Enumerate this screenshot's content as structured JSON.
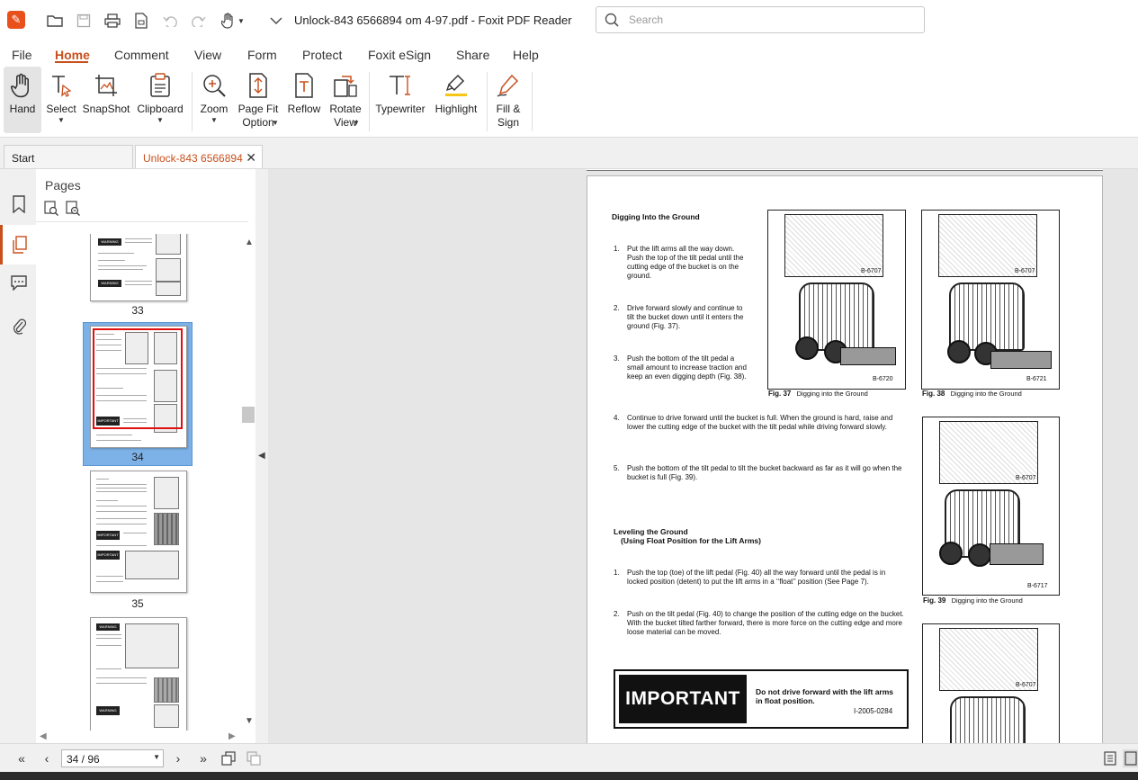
{
  "window": {
    "title": "Unlock-843 6566894 om 4-97.pdf - Foxit PDF Reader"
  },
  "search": {
    "placeholder": "Search"
  },
  "menu": {
    "items": [
      "File",
      "Home",
      "Comment",
      "View",
      "Form",
      "Protect",
      "Foxit eSign",
      "Share",
      "Help"
    ],
    "active": "Home"
  },
  "ribbon": {
    "hand": "Hand",
    "select": "Select",
    "snapshot": "SnapShot",
    "clipboard": "Clipboard",
    "zoom": "Zoom",
    "pagefit": "Page Fit\nOption",
    "reflow": "Reflow",
    "rotate": "Rotate\nView",
    "typewriter": "Typewriter",
    "highlight": "Highlight",
    "fillsign": "Fill &\nSign"
  },
  "tabs": {
    "start": "Start",
    "doc": "Unlock-843 6566894 ..."
  },
  "panel": {
    "title": "Pages",
    "thumbs": [
      "33",
      "34",
      "35"
    ]
  },
  "thumb_text": {
    "important": "IMPORTANT",
    "warning": "WARNING"
  },
  "page": {
    "heading": "Digging Into the Ground",
    "steps": [
      {
        "n": "1.",
        "text": "Put the lift arms all the way down. Push the top of the tilt pedal until the cutting edge of the bucket is on the ground."
      },
      {
        "n": "2.",
        "text": "Drive forward slowly and continue to tilt the bucket down until it enters the ground (Fig. 37)."
      },
      {
        "n": "3.",
        "text": "Push the bottom of the tilt pedal a small amount to increase traction and keep an even digging depth (Fig. 38)."
      },
      {
        "n": "4.",
        "text": "Continue to drive forward until the bucket is full. When the ground is hard, raise and lower the cutting edge of the bucket with the tilt pedal while driving forward slowly."
      },
      {
        "n": "5.",
        "text": "Push the bottom of the tilt pedal to tilt the bucket backward as far as it will go when the bucket is full (Fig. 39)."
      }
    ],
    "heading2": "Leveling the Ground",
    "heading2b": "(Using Float Position for the Lift Arms)",
    "steps2": [
      {
        "n": "1.",
        "text": "Push the top (toe) of the lift pedal (Fig. 40) all the way forward until the pedal is in locked position (detent) to put the lift arms in a ‘‘float’’ position (See Page 7)."
      },
      {
        "n": "2.",
        "text": "Push on the tilt pedal (Fig. 40) to change the position of the cutting edge on the bucket. With the bucket tilted farther forward, there is more force on the cutting edge and more loose material can be moved."
      }
    ],
    "figures": [
      {
        "num": "Fig. 37",
        "caption": "Digging into the Ground",
        "code_top": "B-6707",
        "code_bottom": "B-6720"
      },
      {
        "num": "Fig. 38",
        "caption": "Digging into the Ground",
        "code_top": "B-6707",
        "code_bottom": "B-6721"
      },
      {
        "num": "Fig. 39",
        "caption": "Digging into the Ground",
        "code_top": "B-6707",
        "code_bottom": "B-6717"
      },
      {
        "code_top": "B-6707"
      }
    ],
    "important": {
      "label": "IMPORTANT",
      "text": "Do not drive forward with the lift arms in float position.",
      "code": "I-2005-0284"
    }
  },
  "status": {
    "page": "34 / 96"
  },
  "colors": {
    "accent": "#c8501d",
    "selection": "#7db2e8"
  }
}
